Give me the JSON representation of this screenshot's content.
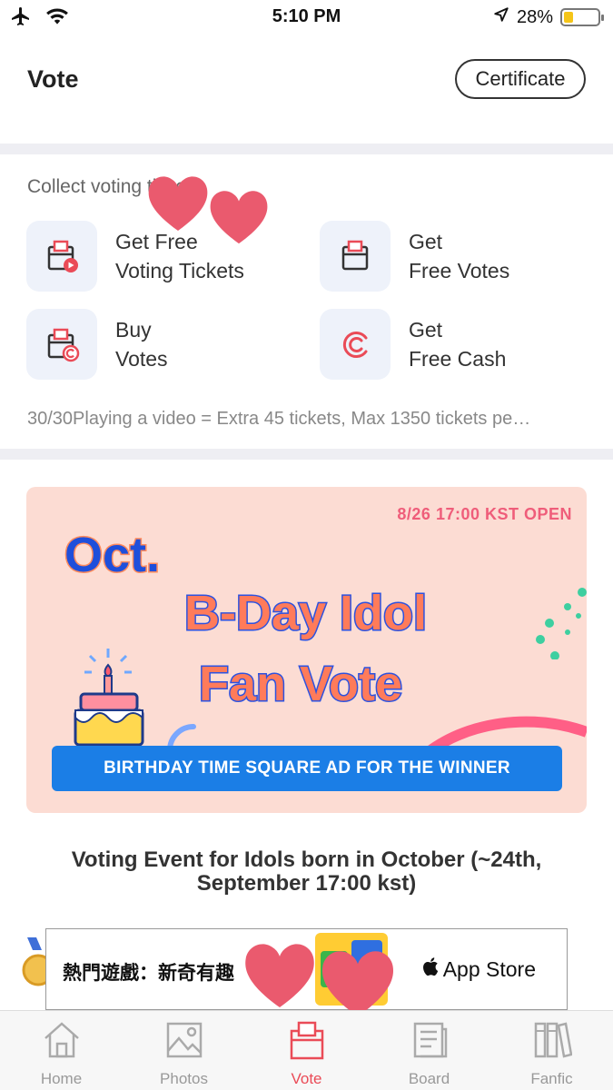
{
  "status_bar": {
    "time": "5:10 PM",
    "battery_percent": "28%",
    "battery_level": 0.28
  },
  "header": {
    "title": "Vote",
    "certificate_label": "Certificate"
  },
  "collect": {
    "label": "Collect voting tickets",
    "tiles": [
      {
        "line1": "Get Free",
        "line2": "Voting Tickets",
        "icon": "ballot-play-icon"
      },
      {
        "line1": "Get",
        "line2": "Free Votes",
        "icon": "ballot-icon"
      },
      {
        "line1": "Buy",
        "line2": "Votes",
        "icon": "ballot-coin-icon"
      },
      {
        "line1": "Get",
        "line2": "Free Cash",
        "icon": "cash-coin-icon"
      }
    ],
    "note": "30/30Playing a video = Extra 45 tickets, Max 1350 tickets pe…"
  },
  "banner": {
    "open_text": "8/26 17:00 KST OPEN",
    "month": "Oct.",
    "headline_1": "B-Day Idol",
    "headline_2": "Fan Vote",
    "bar_text": "BIRTHDAY TIME SQUARE AD FOR THE WINNER"
  },
  "event_title": "Voting Event for Idols born in October (~24th, September 17:00 kst)",
  "ad": {
    "text": "熱門遊戲：新奇有趣",
    "store": "App Store"
  },
  "tabs": [
    {
      "label": "Home",
      "icon": "home-icon",
      "active": false
    },
    {
      "label": "Photos",
      "icon": "photo-icon",
      "active": false
    },
    {
      "label": "Vote",
      "icon": "vote-box-icon",
      "active": true
    },
    {
      "label": "Board",
      "icon": "board-icon",
      "active": false
    },
    {
      "label": "Fanfic",
      "icon": "books-icon",
      "active": false
    }
  ],
  "colors": {
    "accent": "#ea4b57",
    "tile_bg": "#eef2fa",
    "banner_bg": "#fcdcd3",
    "banner_bar": "#1b7ee6"
  }
}
